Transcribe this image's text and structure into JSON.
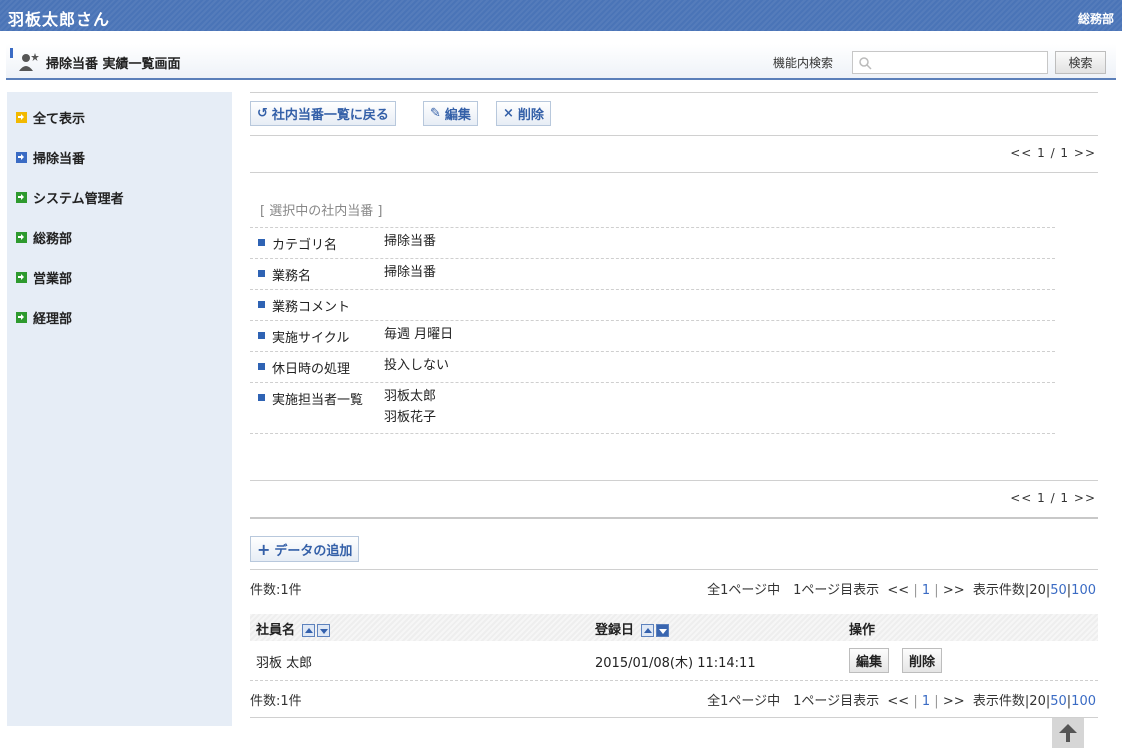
{
  "header": {
    "user": "羽板太郎さん",
    "dept": "総務部"
  },
  "titlebar": {
    "title": "掃除当番 実績一覧画面",
    "search_label": "機能内検索",
    "search_value": "",
    "search_button": "検索"
  },
  "sidebar": {
    "items": [
      {
        "label": "全て表示",
        "color": "#f2b900"
      },
      {
        "label": "掃除当番",
        "color": "#3a6bc4"
      },
      {
        "label": "システム管理者",
        "color": "#2e9a2e"
      },
      {
        "label": "総務部",
        "color": "#2e9a2e"
      },
      {
        "label": "営業部",
        "color": "#2e9a2e"
      },
      {
        "label": "経理部",
        "color": "#2e9a2e"
      }
    ]
  },
  "toolbar": {
    "back_label": "社内当番一覧に戻る",
    "edit_label": "編集",
    "delete_label": "削除"
  },
  "pager_top": "<< 1 / 1 >>",
  "pager_bottom": "<< 1 / 1 >>",
  "selected": {
    "title": "[ 選択中の社内当番 ]",
    "rows": [
      {
        "key": "カテゴリ名",
        "value": "掃除当番"
      },
      {
        "key": "業務名",
        "value": "掃除当番"
      },
      {
        "key": "業務コメント",
        "value": ""
      },
      {
        "key": "実施サイクル",
        "value": "毎週 月曜日"
      },
      {
        "key": "休日時の処理",
        "value": "投入しない"
      },
      {
        "key": "実施担当者一覧",
        "value": "羽板太郎",
        "value2": "羽板花子"
      }
    ]
  },
  "add_button": "データの追加",
  "list": {
    "count": "件数:1件",
    "pageinfo": "全1ページ中　1ページ目表示",
    "nav_prev": "<<",
    "nav_current": "1",
    "nav_next": ">>",
    "per_page_label": "表示件数",
    "per_page_options": [
      "20",
      "50",
      "100"
    ],
    "columns": [
      "社員名",
      "登録日",
      "操作"
    ],
    "rows": [
      {
        "name": "羽板 太郎",
        "date": "2015/01/08(木) 11:14:11",
        "edit": "編集",
        "delete": "削除"
      }
    ]
  },
  "colors": {
    "header": "#4a74b7",
    "accent": "#3460a8",
    "sidebar_bg": "#e6edf6"
  },
  "icons": {
    "back": "undo-icon",
    "edit": "pencil-icon",
    "delete": "x-icon",
    "top": "arrow-up-icon"
  }
}
